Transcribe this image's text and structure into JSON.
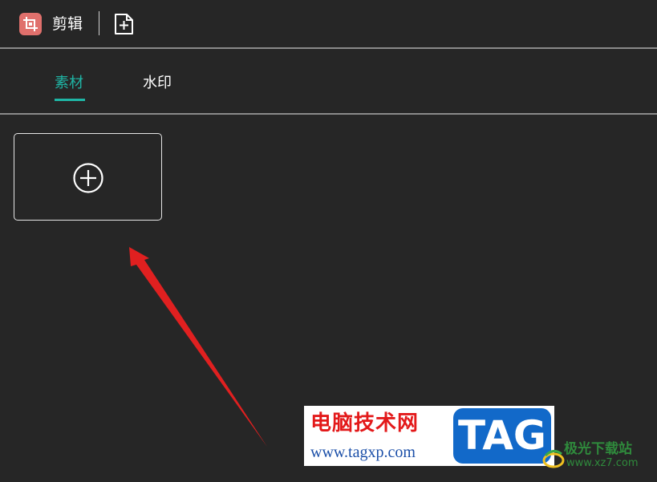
{
  "header": {
    "app_icon": "crop-icon",
    "title": "剪辑",
    "new_file_icon": "new-file-plus-icon"
  },
  "tabs": [
    {
      "label": "素材",
      "active": true
    },
    {
      "label": "水印",
      "active": false
    }
  ],
  "add_material": {
    "icon": "circle-plus-icon"
  },
  "colors": {
    "background": "#262626",
    "accent": "#1fb5a5",
    "app_icon_bg": "#e0706c",
    "annotation_arrow": "#e02020"
  },
  "watermarks": {
    "tagxp": {
      "title": "电脑技术网",
      "url": "www.tagxp.com",
      "badge": "TAG"
    },
    "xz7": {
      "name": "极光下载站",
      "url": "www.xz7.com"
    }
  }
}
